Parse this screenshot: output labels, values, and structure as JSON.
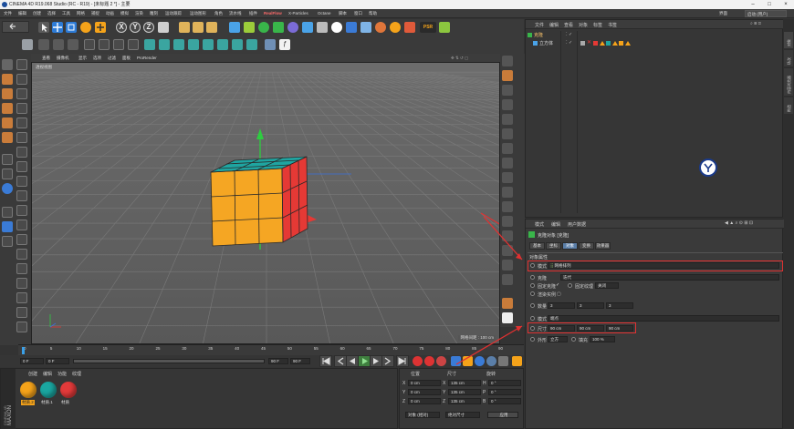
{
  "window": {
    "title": "CINEMA 4D R19.068 Studio (RC - R19) - [未标题 2 *] - 主要",
    "min_glyph": "–",
    "max_glyph": "□",
    "close_glyph": "×"
  },
  "menu": [
    "文件",
    "编辑",
    "创建",
    "选择",
    "工具",
    "网格",
    "捕捉",
    "动画",
    "模拟",
    "渲染",
    "雕刻",
    "运动跟踪",
    "运动图形",
    "角色",
    "流水线",
    "插件",
    "RealFlow",
    "X-Particles",
    "Octane",
    "脚本",
    "窗口",
    "帮助"
  ],
  "layout": {
    "label": "界面",
    "value": "启动 (用户)"
  },
  "toolbar_top": {
    "axis_x": "X",
    "axis_y": "Y",
    "axis_z": "Z",
    "psr": "PSR"
  },
  "viewport": {
    "menu": [
      "查看",
      "摄像机",
      "显示",
      "选项",
      "过滤",
      "面板",
      "ProRender"
    ],
    "camera_label": "透视视图",
    "grid_info": "网格间距 : 100 cm"
  },
  "timeline": {
    "ticks": [
      "0",
      "5",
      "10",
      "15",
      "20",
      "25",
      "30",
      "35",
      "40",
      "45",
      "50",
      "55",
      "60",
      "65",
      "70",
      "75",
      "80",
      "85",
      "90"
    ],
    "start_field": "0 F",
    "current_field": "0 F",
    "end_field": "90 F",
    "end_field2": "90 F",
    "frame_readout": "0 F"
  },
  "materials": {
    "menu": [
      "创建",
      "编辑",
      "功能",
      "纹理"
    ],
    "items": [
      {
        "name": "材质.2",
        "color": "#f5a31a"
      },
      {
        "name": "材质.1",
        "color": "#1aa6a0"
      },
      {
        "name": "材质",
        "color": "#e23a3a"
      }
    ]
  },
  "coords": {
    "headers": [
      "位置",
      "尺寸",
      "旋转"
    ],
    "rows": [
      {
        "axis": "X",
        "pos": "0 cm",
        "size": "135 cm",
        "rot_label": "H",
        "rot": "0 °"
      },
      {
        "axis": "Y",
        "pos": "0 cm",
        "size": "135 cm",
        "rot_label": "P",
        "rot": "0 °"
      },
      {
        "axis": "Z",
        "pos": "0 cm",
        "size": "135 cm",
        "rot_label": "B",
        "rot": "0 °"
      }
    ],
    "mode": "对象 (相对)",
    "size_mode": "绝对尺寸",
    "apply": "应用"
  },
  "objects": {
    "menu": [
      "文件",
      "编辑",
      "查看",
      "对象",
      "标签",
      "书签"
    ],
    "items": [
      {
        "name": "克隆",
        "indent": 0
      },
      {
        "name": "立方体",
        "indent": 1
      }
    ]
  },
  "side_tabs": [
    "对象",
    "场次",
    "内容浏览器",
    "构造"
  ],
  "attributes": {
    "menu": [
      "模式",
      "编辑",
      "用户数据"
    ],
    "object_title": "克隆对象 [克隆]",
    "tabs": [
      "基本",
      "坐标",
      "对象",
      "变换",
      "效果器"
    ],
    "active_tab": "对象",
    "section": "对象属性",
    "mode_label": "模式",
    "mode_value": "网格排列",
    "clones_label": "克隆",
    "clones_value": "迭代",
    "fix_clone_label": "固定克隆",
    "fix_texture_label": "固定纹理",
    "fix_texture_value": "关闭",
    "instance_mode_label": "渲染实例",
    "count_label": "数量",
    "count": [
      "3",
      "3",
      "3"
    ],
    "size_mode_label": "模式",
    "size_mode_value": "端点",
    "size_label": "尺寸",
    "size": [
      "90 cm",
      "90 cm",
      "90 cm"
    ],
    "shape_label": "外形",
    "shape_value": "立方",
    "fill_label": "填充",
    "fill_value": "100 %"
  },
  "colors": {
    "cube_top": "#1fa5a1",
    "cube_front": "#f5a623",
    "cube_right": "#e53935",
    "axis_y": "#2ecc40",
    "axis_x": "#e53935",
    "axis_z": "#3b6fd8",
    "annotation": "#e03131"
  }
}
